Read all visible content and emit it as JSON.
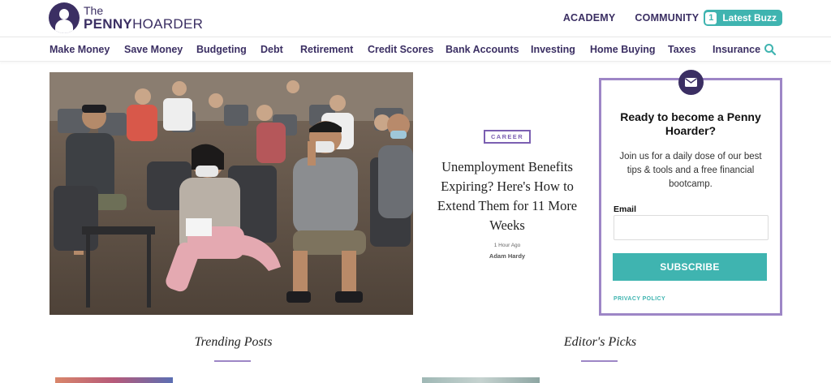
{
  "header": {
    "logo": {
      "the": "The",
      "penny": "PENNY",
      "hoarder": "HOARDER"
    },
    "links": [
      "ACADEMY",
      "COMMUNITY"
    ],
    "buzz": {
      "count": "1",
      "label": "Latest Buzz"
    }
  },
  "nav": {
    "items": [
      "Make Money",
      "Save Money",
      "Budgeting",
      "Debt",
      "Retirement",
      "Credit Scores",
      "Bank Accounts",
      "Investing",
      "Home Buying",
      "Taxes",
      "Insurance"
    ],
    "search_icon": "search-icon"
  },
  "feature": {
    "tag": "CAREER",
    "headline": "Unemployment Benefits Expiring? Here's How to Extend Them for 11 More Weeks",
    "time": "1 Hour Ago",
    "author": "Adam Hardy"
  },
  "signup": {
    "title": "Ready to become a Penny Hoarder?",
    "description": "Join us for a daily dose of our best tips & tools and a free financial bootcamp.",
    "email_label": "Email",
    "email_value": "",
    "button": "SUBSCRIBE",
    "privacy": "PRIVACY POLICY"
  },
  "sections": {
    "trending": "Trending Posts",
    "editors": "Editor's Picks"
  },
  "colors": {
    "brand_purple": "#3b2f63",
    "accent_teal": "#3fb4b0",
    "box_border": "#9d86c6",
    "tag_purple": "#7b5fb1"
  }
}
